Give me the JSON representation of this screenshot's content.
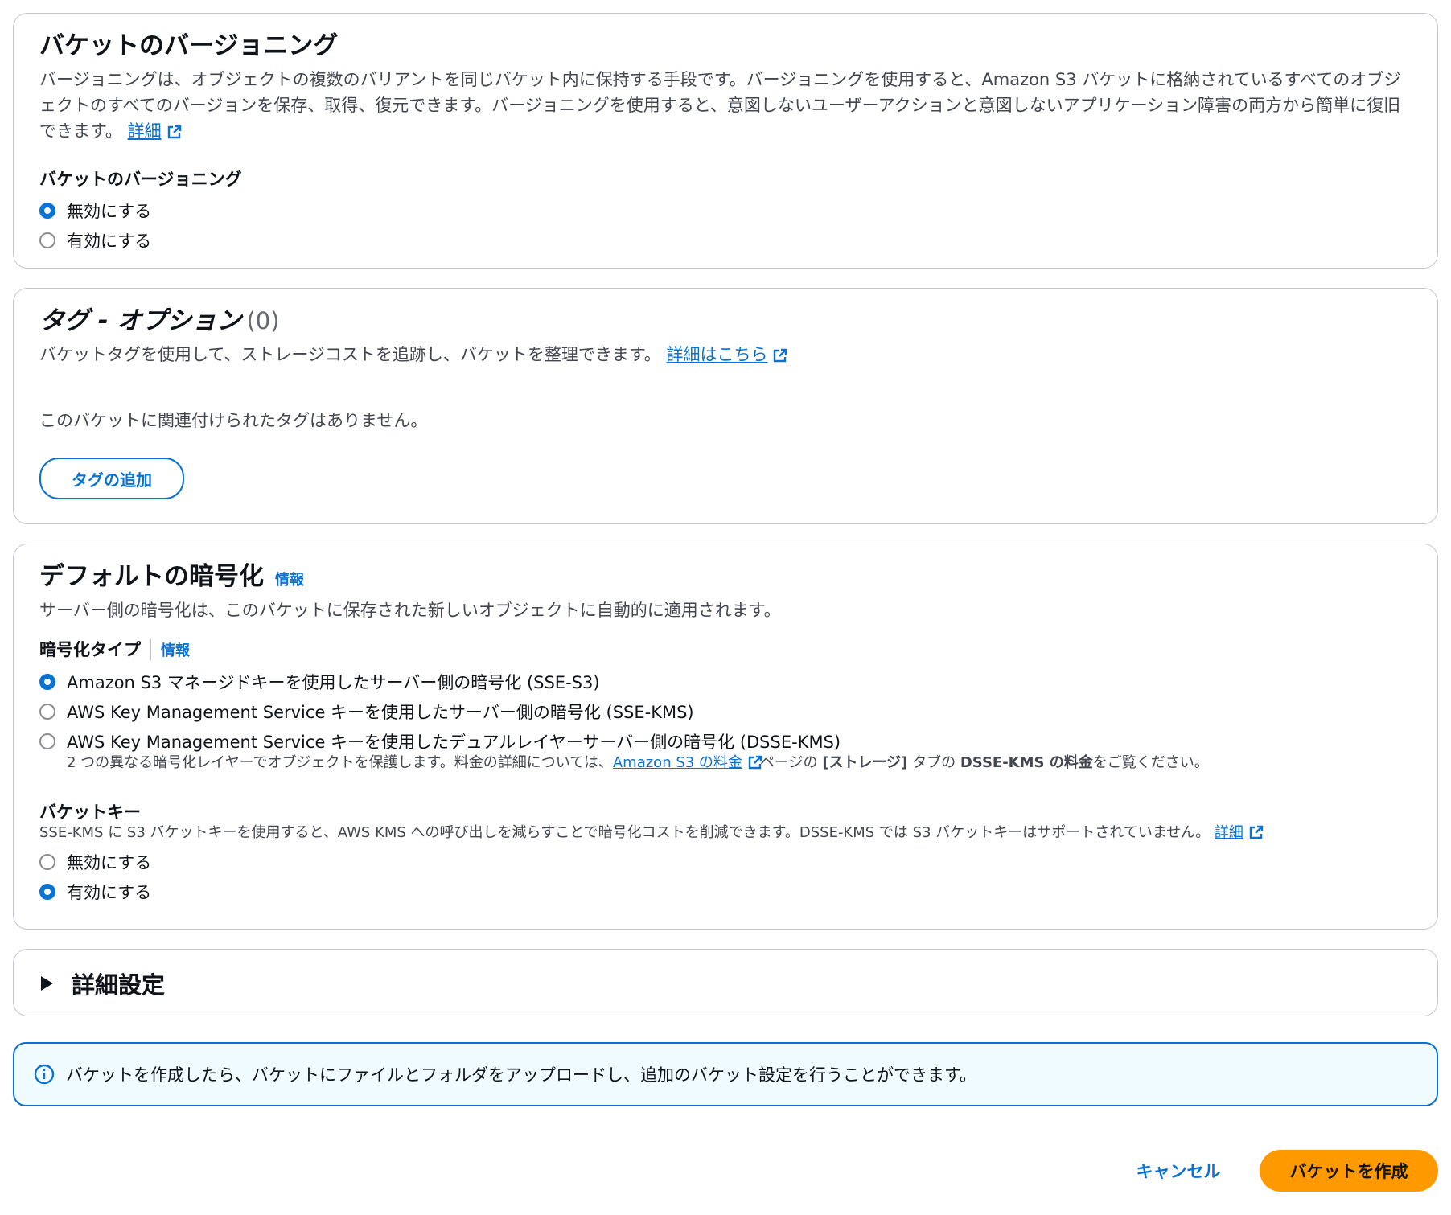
{
  "versioning": {
    "title": "バケットのバージョニング",
    "description": "バージョニングは、オブジェクトの複数のバリアントを同じバケット内に保持する手段です。バージョニングを使用すると、Amazon S3 バケットに格納されているすべてのオブジェクトのすべてのバージョンを保存、取得、復元できます。バージョニングを使用すると、意図しないユーザーアクションと意図しないアプリケーション障害の両方から簡単に復旧できます。",
    "learn_more": "詳細",
    "field_label": "バケットのバージョニング",
    "options": [
      {
        "label": "無効にする",
        "selected": true
      },
      {
        "label": "有効にする",
        "selected": false
      }
    ]
  },
  "tags": {
    "title": "タグ - オプション",
    "count": "(0)",
    "description": "バケットタグを使用して、ストレージコストを追跡し、バケットを整理できます。",
    "learn_more": "詳細はこちら",
    "empty_text": "このバケットに関連付けられたタグはありません。",
    "add_button": "タグの追加"
  },
  "encryption": {
    "title": "デフォルトの暗号化",
    "info": "情報",
    "description": "サーバー側の暗号化は、このバケットに保存された新しいオブジェクトに自動的に適用されます。",
    "type_label": "暗号化タイプ",
    "type_info": "情報",
    "options": [
      {
        "label": "Amazon S3 マネージドキーを使用したサーバー側の暗号化 (SSE-S3)",
        "selected": true
      },
      {
        "label": "AWS Key Management Service キーを使用したサーバー側の暗号化 (SSE-KMS)",
        "selected": false
      },
      {
        "label": "AWS Key Management Service キーを使用したデュアルレイヤーサーバー側の暗号化 (DSSE-KMS)",
        "selected": false
      }
    ],
    "dsse_hint_pre": "2 つの異なる暗号化レイヤーでオブジェクトを保護します。料金の詳細については、",
    "dsse_hint_link": "Amazon S3 の料金",
    "dsse_hint_mid": "ページの ",
    "dsse_hint_bold1": "[ストレージ]",
    "dsse_hint_mid2": " タブの ",
    "dsse_hint_bold2": "DSSE-KMS の料金",
    "dsse_hint_post": "をご覧ください。",
    "bucket_key_label": "バケットキー",
    "bucket_key_desc": "SSE-KMS に S3 バケットキーを使用すると、AWS KMS への呼び出しを減らすことで暗号化コストを削減できます。DSSE-KMS では S3 バケットキーはサポートされていません。",
    "bucket_key_link": "詳細",
    "bucket_key_options": [
      {
        "label": "無効にする",
        "selected": false
      },
      {
        "label": "有効にする",
        "selected": true
      }
    ]
  },
  "advanced": {
    "title": "詳細設定"
  },
  "alert": {
    "text": "バケットを作成したら、バケットにファイルとフォルダをアップロードし、追加のバケット設定を行うことができます。"
  },
  "footer": {
    "cancel": "キャンセル",
    "create": "バケットを作成"
  },
  "colors": {
    "accent": "#0972d3",
    "primary_button": "#ff9900",
    "alert_bg": "#f0fbff"
  }
}
